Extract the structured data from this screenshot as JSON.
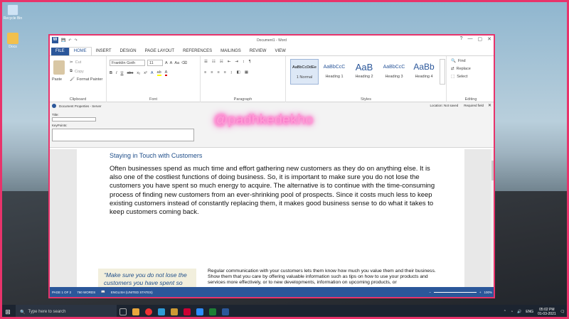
{
  "desktop": {
    "icons": [
      {
        "label": "Recycle Bin"
      },
      {
        "label": "Docs"
      }
    ]
  },
  "window": {
    "title": "Document1 - Word",
    "controls": [
      "?",
      "—",
      "▢",
      "✕"
    ]
  },
  "ribbon_tabs": [
    "FILE",
    "HOME",
    "INSERT",
    "DESIGN",
    "PAGE LAYOUT",
    "REFERENCES",
    "MAILINGS",
    "REVIEW",
    "VIEW"
  ],
  "clipboard": {
    "paste": "Paste",
    "cut": "Cut",
    "copy": "Copy",
    "format_painter": "Format Painter",
    "label": "Clipboard"
  },
  "font": {
    "name": "Franklin Goth",
    "size": "11",
    "label": "Font"
  },
  "paragraph": {
    "label": "Paragraph"
  },
  "styles": {
    "label": "Styles",
    "items": [
      {
        "preview": "AaBbCcDdEe",
        "name": "1 Normal"
      },
      {
        "preview": "AaBbCcC",
        "name": "Heading 1"
      },
      {
        "preview": "AaB",
        "name": "Heading 2"
      },
      {
        "preview": "AaBbCcC",
        "name": "Heading 3"
      },
      {
        "preview": "AaBb",
        "name": "Heading 4"
      }
    ]
  },
  "editing": {
    "find": "Find",
    "replace": "Replace",
    "select": "Select",
    "label": "Editing"
  },
  "doc_props": {
    "title": "Document Properties - Server",
    "location": "Location: Not saved",
    "required": "Required field",
    "field_title": "Title:",
    "field_keypoints": "KeyPoints:"
  },
  "document": {
    "heading": "Staying in Touch with Customers",
    "body": "Often businesses spend as much time and effort gathering new customers as they do on anything else. It is also one of the costliest functions of doing business. So, it is important to make sure you do not lose the customers you have spent so much energy to acquire. The alternative is to continue with the time-consuming process of finding new customers from an ever-shrinking pool of prospects. Since it costs much less to keep existing customers instead of constantly replacing them, it makes good business sense to do what it takes to keep customers coming back.",
    "pullquote": "“Make sure you do not lose the customers you have spent so much",
    "secondary": "Regular communication with your customers lets them know how much you value them and their business. Show them that you care by offering valuable information such as tips on how to use your products and services more effectively, or to new developments, information on upcoming products, or"
  },
  "status": {
    "page": "PAGE 1 OF 2",
    "words": "760 WORDS",
    "language": "ENGLISH (UNITED STATES)",
    "zoom": "100%"
  },
  "taskbar": {
    "search": "Type here to search",
    "lang": "ENG",
    "time": "05:02 PM",
    "date": "01-03-2021"
  },
  "overlay": {
    "text": "@padhkedekho"
  }
}
